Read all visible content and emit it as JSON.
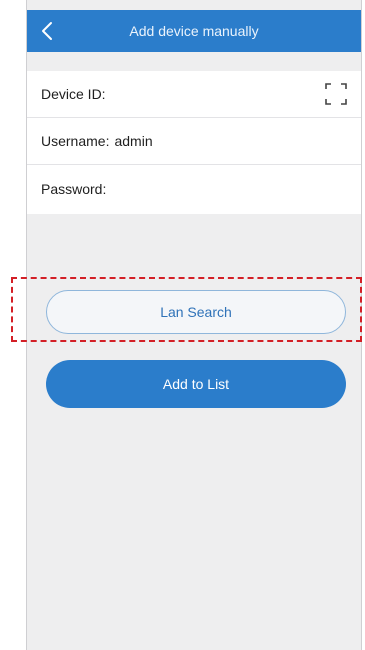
{
  "header": {
    "title": "Add device manually",
    "back_icon": "chevron-left-icon"
  },
  "form": {
    "device_id": {
      "label": "Device ID:",
      "value": "",
      "scan_icon": "scan-frame-icon"
    },
    "username": {
      "label": "Username:",
      "value": "admin"
    },
    "password": {
      "label": "Password:",
      "value": ""
    }
  },
  "buttons": {
    "lan_search": "Lan Search",
    "add_to_list": "Add to List"
  },
  "colors": {
    "primary": "#2b7dcb",
    "background": "#eeeeef",
    "highlight": "#d31f26"
  }
}
